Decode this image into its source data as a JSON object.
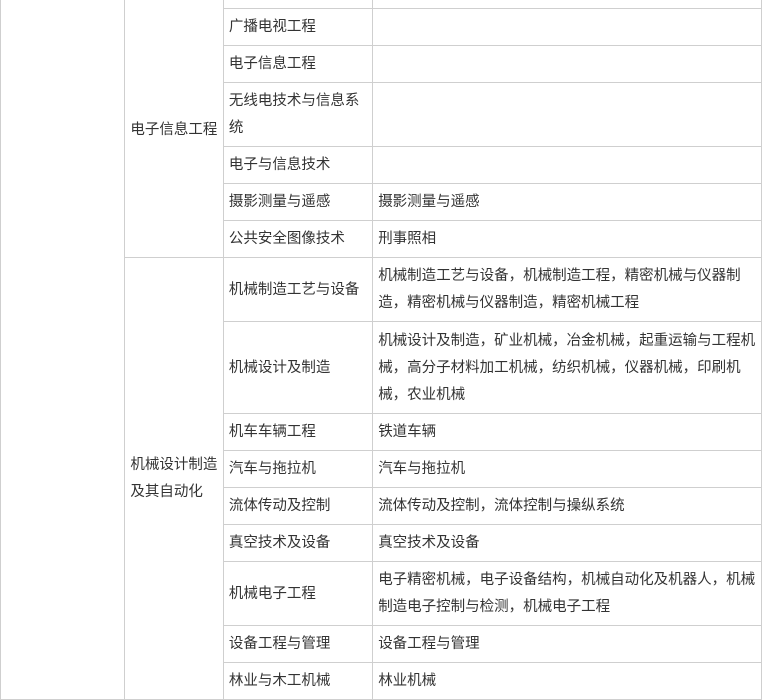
{
  "groups": [
    {
      "name": "电子信息工程",
      "rows": [
        {
          "major": "",
          "old": ""
        },
        {
          "major": "广播电视工程",
          "old": ""
        },
        {
          "major": "电子信息工程",
          "old": ""
        },
        {
          "major": "无线电技术与信息系统",
          "old": ""
        },
        {
          "major": "电子与信息技术",
          "old": ""
        },
        {
          "major": "摄影测量与遥感",
          "old": "摄影测量与遥感"
        },
        {
          "major": "公共安全图像技术",
          "old": "刑事照相"
        }
      ]
    },
    {
      "name": "机械设计制造及其自动化",
      "rows": [
        {
          "major": "机械制造工艺与设备",
          "old": "机械制造工艺与设备，机械制造工程，精密机械与仪器制造，精密机械与仪器制造，精密机械工程"
        },
        {
          "major": "机械设计及制造",
          "old": "机械设计及制造，矿业机械，冶金机械，起重运输与工程机械，高分子材料加工机械，纺织机械，仪器机械，印刷机械，农业机械"
        },
        {
          "major": "机车车辆工程",
          "old": "铁道车辆"
        },
        {
          "major": "汽车与拖拉机",
          "old": "汽车与拖拉机"
        },
        {
          "major": "流体传动及控制",
          "old": "流体传动及控制，流体控制与操纵系统"
        },
        {
          "major": "真空技术及设备",
          "old": "真空技术及设备"
        },
        {
          "major": "机械电子工程",
          "old": "电子精密机械，电子设备结构，机械自动化及机器人，机械制造电子控制与检测，机械电子工程"
        },
        {
          "major": "设备工程与管理",
          "old": "设备工程与管理"
        },
        {
          "major": "林业与木工机械",
          "old": "林业机械"
        }
      ]
    }
  ]
}
